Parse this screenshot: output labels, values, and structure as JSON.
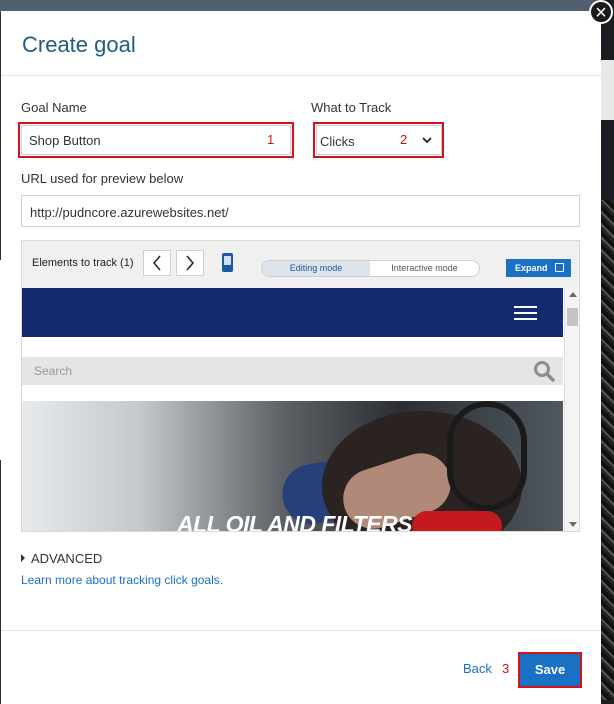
{
  "dialog": {
    "title": "Create goal",
    "close_glyph": "×"
  },
  "goal_name": {
    "label": "Goal Name",
    "value": "Shop Button",
    "annotation": "1"
  },
  "what_to_track": {
    "label": "What to Track",
    "value": "Clicks",
    "annotation": "2"
  },
  "url": {
    "label": "URL used for preview below",
    "value": "http://pudncore.azurewebsites.net/"
  },
  "preview": {
    "elements_label": "Elements to track (1)",
    "prev_glyph": "‹",
    "next_glyph": "›",
    "mode_editing": "Editing mode",
    "mode_interactive": "Interactive mode",
    "expand_label": "Expand"
  },
  "site": {
    "search_placeholder": "Search",
    "hero_text": "ALL OIL AND FILTERS",
    "nav_color": "#132a6e"
  },
  "advanced_label": "ADVANCED",
  "learn_link": "Learn more about tracking click goals.",
  "footer": {
    "back_label": "Back",
    "save_label": "Save",
    "annotation": "3"
  },
  "colors": {
    "accent": "#1a71c4",
    "title": "#1f5e82",
    "annotation": "#d3111a"
  }
}
